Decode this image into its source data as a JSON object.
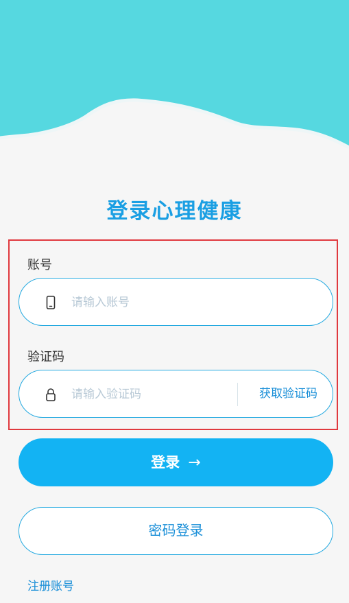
{
  "title": "登录心理健康",
  "account": {
    "label": "账号",
    "placeholder": "请输入账号",
    "icon": "phone-icon"
  },
  "code": {
    "label": "验证码",
    "placeholder": "请输入验证码",
    "icon": "lock-icon",
    "get_code_label": "获取验证码"
  },
  "login_button": {
    "label": "登录",
    "arrow": "→"
  },
  "password_login_label": "密码登录",
  "register_label": "注册账号",
  "colors": {
    "header_teal": "#56d8e0",
    "accent": "#1a9fe3",
    "button": "#13b3f3",
    "highlight_border": "#e0393e"
  }
}
